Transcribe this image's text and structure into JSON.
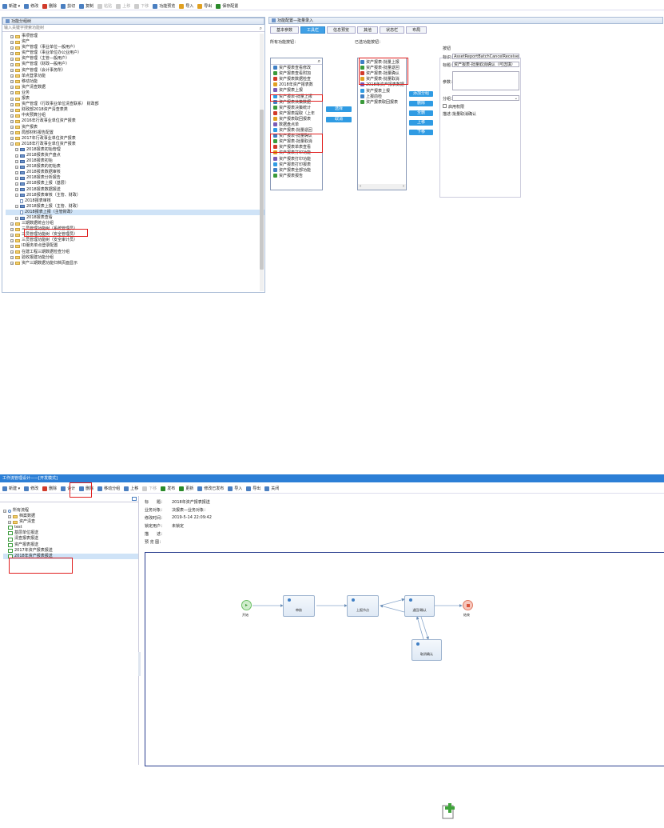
{
  "top": {
    "toolbar": [
      {
        "label": "新建 ▾",
        "color": "#4a7fc1"
      },
      {
        "label": "修改",
        "color": "#4a7fc1"
      },
      {
        "label": "删除",
        "color": "#d13a2a"
      },
      {
        "label": "剪切",
        "color": "#4a7fc1"
      },
      {
        "label": "复制",
        "color": "#4a7fc1"
      },
      {
        "label": "粘贴",
        "color": "#999",
        "disabled": true
      },
      {
        "label": "上移",
        "color": "#999",
        "disabled": true
      },
      {
        "label": "下移",
        "color": "#999",
        "disabled": true
      },
      {
        "label": "功能预览",
        "color": "#4a7fc1"
      },
      {
        "label": "导入",
        "color": "#e0a020"
      },
      {
        "label": "导出",
        "color": "#e0a020"
      },
      {
        "label": "保存配置",
        "color": "#2a8a2a"
      }
    ],
    "left_panel_title": "功能分组树",
    "search_placeholder": "输入关键字搜索功能树",
    "tree": [
      {
        "t": "事项管理",
        "d": 1,
        "k": "f"
      },
      {
        "t": "资产",
        "d": 1,
        "k": "f"
      },
      {
        "t": "资产管理（事业单位—般用户）",
        "d": 1,
        "k": "f"
      },
      {
        "t": "资产管理（事业单位办公业用户）",
        "d": 1,
        "k": "f"
      },
      {
        "t": "资产管理（主管—般用户）",
        "d": 1,
        "k": "f"
      },
      {
        "t": "资产管理（财政—般用户）",
        "d": 1,
        "k": "f"
      },
      {
        "t": "资产管理（会计事务所）",
        "d": 1,
        "k": "f"
      },
      {
        "t": "单点登录功能",
        "d": 1,
        "k": "f"
      },
      {
        "t": "移动功能",
        "d": 1,
        "k": "f"
      },
      {
        "t": "资产清查数据",
        "d": 1,
        "k": "f"
      },
      {
        "t": "业务",
        "d": 1,
        "k": "f"
      },
      {
        "t": "报表",
        "d": 1,
        "k": "f"
      },
      {
        "t": "资产管理（行政事业单位清查联系） 财政部",
        "d": 1,
        "k": "f"
      },
      {
        "t": "财政部2018资产清查表类",
        "d": 1,
        "k": "f"
      },
      {
        "t": "中央预算分组",
        "d": 1,
        "k": "f"
      },
      {
        "t": "2016年行政事业单位资产报表",
        "d": 1,
        "k": "f"
      },
      {
        "t": "资产报表",
        "d": 1,
        "k": "f"
      },
      {
        "t": "局部材料报告配置",
        "d": 1,
        "k": "f"
      },
      {
        "t": "2017年行政事业单位资产报表",
        "d": 1,
        "k": "f"
      },
      {
        "t": "2018年行政事业单位资产报表",
        "d": 1,
        "k": "f",
        "open": true
      },
      {
        "t": "2018报表初始管理",
        "d": 2,
        "k": "b"
      },
      {
        "t": "2018报表资产盘点",
        "d": 2,
        "k": "b"
      },
      {
        "t": "2018报表初始",
        "d": 2,
        "k": "b"
      },
      {
        "t": "2018报表的初始表",
        "d": 2,
        "k": "b"
      },
      {
        "t": "2018报表数据审核",
        "d": 2,
        "k": "b"
      },
      {
        "t": "2018报表分析报告",
        "d": 2,
        "k": "b"
      },
      {
        "t": "2018报表上报（基层）",
        "d": 2,
        "k": "b"
      },
      {
        "t": "2018报表数据报送",
        "d": 2,
        "k": "b"
      },
      {
        "t": "2018报表审核（主管、财政）",
        "d": 2,
        "k": "b",
        "open": true
      },
      {
        "t": "2018报表审核",
        "d": 3,
        "k": "d"
      },
      {
        "t": "2018报表上报（主管、财政）",
        "d": 2,
        "k": "b",
        "open": true
      },
      {
        "t": "2018报表上报（主管财政）",
        "d": 3,
        "k": "d",
        "sel": true
      },
      {
        "t": "2018报表查看",
        "d": 2,
        "k": "b"
      },
      {
        "t": "三期数据统合分组",
        "d": 1,
        "k": "f"
      },
      {
        "t": "三员管理功能树（系统管理员）",
        "d": 1,
        "k": "f"
      },
      {
        "t": "三员管理功能树（安全管理员）",
        "d": 1,
        "k": "f"
      },
      {
        "t": "三员管理功能树（安全审计员）",
        "d": 1,
        "k": "f"
      },
      {
        "t": "ID服务单点登录配置",
        "d": 1,
        "k": "f"
      },
      {
        "t": "在建工程三期数据检查分组",
        "d": 1,
        "k": "f"
      },
      {
        "t": "验收报建功能分组",
        "d": 1,
        "k": "f"
      },
      {
        "t": "资产三期数据功能归档页面显示",
        "d": 1,
        "k": "f"
      }
    ],
    "right_panel_title": "功能配置—批量录入",
    "tabs": [
      "基本参数",
      "工具栏",
      "信息预览",
      "其他",
      "状态栏",
      "布局"
    ],
    "all_funcs_label": "所有功能按钮：",
    "selected_funcs_label": "已选功能按钮：",
    "all_funcs": [
      "资产报表查看修改",
      "资产报表查看附加",
      "资产报表数据检查",
      "2018年资产报表数",
      "资产报表上报",
      "资产报表-批量上报",
      "资产报表决策数据",
      "资产报表决策统计",
      "资产报表提取（上年",
      "资产报表取回报表",
      "数据盘点单",
      "资产报表-批量退回",
      "资产报表-批量确认",
      "资产报表-批量取消",
      "资产报表单表查看",
      "资产报表打印功能",
      "资产报表打印功能",
      "资产报表打印报表",
      "资产报表全部功能",
      "资产报表报告"
    ],
    "selected_funcs": [
      "资产报表-批量上报",
      "资产报表-批量退回",
      "资产报表-批量确认",
      "资产报表-批量取消",
      "2018年资产报表数据",
      "资产报表上报",
      "上报前检",
      "资产报表取回报表"
    ],
    "btn_select": "选择",
    "btn_cancel": "取消",
    "side_btns": [
      "添加分组",
      "删除",
      "全删",
      "上移",
      "下移"
    ],
    "prop": {
      "title": "按钮",
      "id_label": "标识：",
      "id_value": "AssetReportBatchCancelReceive",
      "name_label": "标题：",
      "name_value": "资产报表-批量取消确认（可选填）",
      "param_label": "参数：",
      "group_label": "分组：",
      "enable_label": "启用权限",
      "desc_label": "描述：",
      "desc_value": "批量取消确认"
    }
  },
  "bottom": {
    "window_title": "工作流管理设计——[开发模式]",
    "toolbar": [
      {
        "label": "新建 ▾",
        "color": "#4a7fc1"
      },
      {
        "label": "修改",
        "color": "#4a7fc1"
      },
      {
        "label": "删除",
        "color": "#d13a2a"
      },
      {
        "label": "设计",
        "color": "#4a7fc1"
      },
      {
        "label": "删除",
        "color": "#4a7fc1"
      },
      {
        "label": "移动分组",
        "color": "#4a7fc1"
      },
      {
        "label": "上移",
        "color": "#4a7fc1"
      },
      {
        "label": "下移",
        "color": "#999",
        "disabled": true
      },
      {
        "label": "发布",
        "color": "#2a8a2a"
      },
      {
        "label": "更新",
        "color": "#2a8a2a"
      },
      {
        "label": "修改已发布",
        "color": "#4a7fc1"
      },
      {
        "label": "导入",
        "color": "#4a7fc1"
      },
      {
        "label": "导出",
        "color": "#4a7fc1"
      },
      {
        "label": "关闭",
        "color": "#4a7fc1"
      }
    ],
    "tree": [
      {
        "t": "所有流程",
        "d": 0,
        "k": "r"
      },
      {
        "t": "档案数据",
        "d": 1,
        "k": "f"
      },
      {
        "t": "资产清查",
        "d": 1,
        "k": "f"
      },
      {
        "t": "test",
        "d": 1,
        "k": "w"
      },
      {
        "t": "基层单位报送",
        "d": 1,
        "k": "w"
      },
      {
        "t": "清查报表报送",
        "d": 1,
        "k": "w"
      },
      {
        "t": "资产报表报送",
        "d": 1,
        "k": "w"
      },
      {
        "t": "2017年资产报表报送",
        "d": 1,
        "k": "w"
      },
      {
        "t": "2018年资产报表报送",
        "d": 1,
        "k": "w",
        "sel": true
      }
    ],
    "info": [
      {
        "k": "标　　题：",
        "v": "2018年资产报表报送"
      },
      {
        "k": "业务对象：",
        "v": "决报表—业务对象："
      },
      {
        "k": "修改时间：",
        "v": "2019-5-14 22:09:42"
      },
      {
        "k": "锁定用户：",
        "v": "未锁定"
      },
      {
        "k": "描　　述：",
        "v": ""
      },
      {
        "k": "预 览 图：",
        "v": ""
      }
    ],
    "flow": {
      "start": "开始",
      "audit": "审核",
      "submit": "上报节点",
      "confirm": "退回/确认",
      "cancel": "取消确认",
      "end": "结束"
    }
  }
}
